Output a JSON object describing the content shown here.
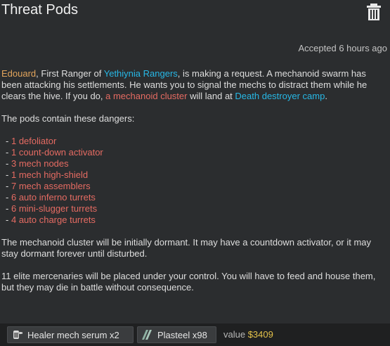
{
  "header": {
    "title": "Threat Pods",
    "accepted": "Accepted 6 hours ago"
  },
  "intro": {
    "requester": "Edouard",
    "text1": ", First Ranger of ",
    "faction": "Yethiynia Rangers",
    "text2": ", is making a request. A mechanoid swarm has been attacking his settlements. He wants you to signal the mechs to distract them while he clears the hive. If you do, ",
    "threat": "a mechanoid cluster",
    "text3": " will land at ",
    "location": "Death destroyer camp",
    "text4": "."
  },
  "dangers_heading": "The pods contain these dangers:",
  "dangers": [
    {
      "count": "1",
      "name": "defoliator"
    },
    {
      "count": "1",
      "name": "count-down activator"
    },
    {
      "count": "3",
      "name": "mech nodes"
    },
    {
      "count": "1",
      "name": "mech high-shield"
    },
    {
      "count": "7",
      "name": "mech assemblers"
    },
    {
      "count": "6",
      "name": "auto inferno turrets"
    },
    {
      "count": "6",
      "name": "mini-slugger turrets"
    },
    {
      "count": "4",
      "name": "auto charge turrets"
    }
  ],
  "paragraph_dormant": "The mechanoid cluster will be initially dormant. It may have a countdown activator, or it may stay dormant forever until disturbed.",
  "paragraph_mercs": "11 elite mercenaries will be placed under your control. You will have to feed and house them, but they may die in battle without consequence.",
  "rewards": [
    {
      "label": "Healer mech serum x2",
      "icon": "serum-icon"
    },
    {
      "label": "Plasteel x98",
      "icon": "plasteel-icon"
    }
  ],
  "value": {
    "label": "value",
    "amount": "$3409"
  },
  "colors": {
    "background": "#2b2d2f",
    "orange": "#e3a55c",
    "cyan": "#27b8e6",
    "red": "#e56b62",
    "gold": "#e3c14a"
  }
}
